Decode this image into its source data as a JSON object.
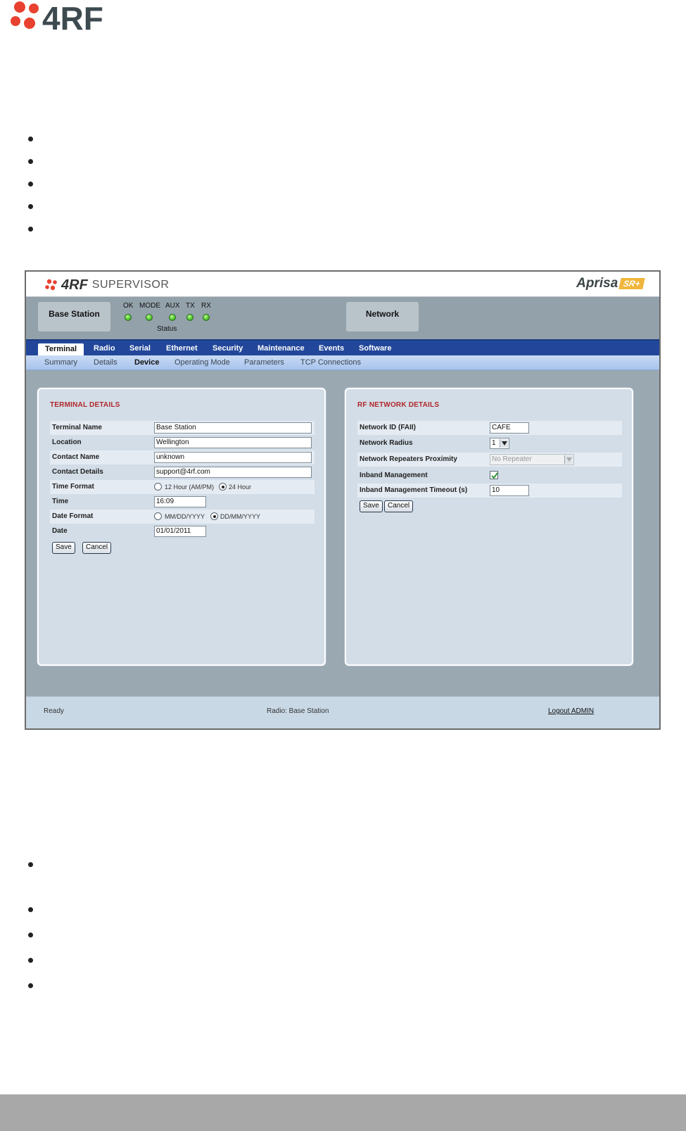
{
  "page": {
    "logo_text": "4RF",
    "footer_color": "#a8a8a8"
  },
  "header": {
    "logo_text": "4RF",
    "product_label": "SUPERVISOR",
    "brand_name": "Aprisa",
    "brand_badge": "SR+"
  },
  "status": {
    "terminal_button": "Base Station",
    "network_button": "Network",
    "leds": [
      {
        "label": "OK",
        "state": "green"
      },
      {
        "label": "MODE",
        "state": "green"
      },
      {
        "label": "AUX",
        "state": "green"
      },
      {
        "label": "TX",
        "state": "green"
      },
      {
        "label": "RX",
        "state": "green"
      }
    ],
    "group_label": "Status"
  },
  "main_nav": {
    "tabs": [
      "Terminal",
      "Radio",
      "Serial",
      "Ethernet",
      "Security",
      "Maintenance",
      "Events",
      "Software"
    ],
    "active": "Terminal"
  },
  "sub_nav": {
    "items": [
      "Summary",
      "Details",
      "Device",
      "Operating Mode",
      "Parameters",
      "TCP Connections"
    ],
    "active": "Device"
  },
  "terminal_details": {
    "title": "TERMINAL DETAILS",
    "fields": {
      "terminal_name": {
        "label": "Terminal Name",
        "value": "Base Station"
      },
      "location": {
        "label": "Location",
        "value": "Wellington"
      },
      "contact_name": {
        "label": "Contact Name",
        "value": "unknown"
      },
      "contact_details": {
        "label": "Contact Details",
        "value": "support@4rf.com"
      },
      "time_format": {
        "label": "Time Format",
        "options": [
          "12 Hour (AM/PM)",
          "24 Hour"
        ],
        "selected": "24 Hour"
      },
      "time": {
        "label": "Time",
        "value": "16:09"
      },
      "date_format": {
        "label": "Date Format",
        "options": [
          "MM/DD/YYYY",
          "DD/MM/YYYY"
        ],
        "selected": "DD/MM/YYYY"
      },
      "date": {
        "label": "Date",
        "value": "01/01/2011"
      }
    },
    "save_label": "Save",
    "cancel_label": "Cancel"
  },
  "rf_network_details": {
    "title": "RF NETWORK DETAILS",
    "fields": {
      "network_id": {
        "label": "Network ID (FAII)",
        "value": "CAFE"
      },
      "network_radius": {
        "label": "Network Radius",
        "value": "1"
      },
      "repeaters_proximity": {
        "label": "Network Repeaters Proximity",
        "value": "No Repeater"
      },
      "inband_management": {
        "label": "Inband Management",
        "checked": true
      },
      "inband_timeout": {
        "label": "Inband Management Timeout (s)",
        "value": "10"
      }
    },
    "save_label": "Save",
    "cancel_label": "Cancel"
  },
  "footer": {
    "status": "Ready",
    "radio": "Radio: Base Station",
    "logout": "Logout ADMIN"
  }
}
